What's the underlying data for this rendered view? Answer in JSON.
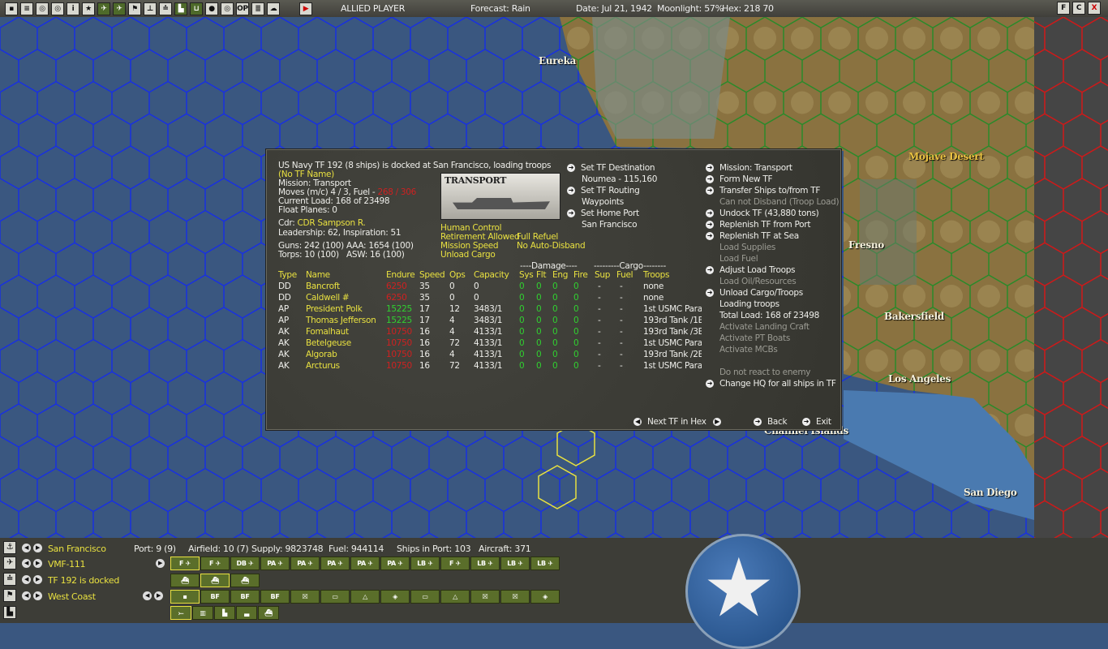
{
  "topbar": {
    "player": "ALLIED PLAYER",
    "forecast": "Forecast: Rain",
    "date": "Date: Jul 21, 1942",
    "moonlight": "Moonlight: 57%",
    "hex": "Hex: 218 70",
    "icons": [
      "save-icon",
      "report-icon",
      "intel-icon",
      "intel2-icon",
      "info-icon",
      "star-icon",
      "plane-red-icon",
      "plane-blue-icon",
      "flag-icon",
      "ship-icon",
      "ships-icon",
      "factory-icon",
      "base-icon",
      "globe-icon",
      "globe2-icon",
      "op-icon",
      "list-icon",
      "cloud-icon",
      "play-icon"
    ],
    "icon_glyphs": [
      "▪",
      "≡",
      "◎",
      "◎",
      "i",
      "★",
      "✈",
      "✈",
      "⚑",
      "⊥",
      "≐",
      "▙",
      "⊔",
      "●",
      "◎",
      "OP",
      "≣",
      "☁",
      "▶"
    ],
    "right_icons": [
      "F",
      "C",
      "X"
    ]
  },
  "map": {
    "labels": [
      "Eureka",
      "Mojave Desert",
      "Fresno",
      "Bakersfield",
      "Los Angeles",
      "Channel Islands",
      "San Diego"
    ]
  },
  "dialog": {
    "title": "US Navy TF 192 (8 ships) is docked at San Francisco, loading troops",
    "tf_name": "(No TF Name)",
    "mission": "Mission:  Transport",
    "moves": "Moves (m/c)  4 / 3, Fuel - ",
    "fuel": "268 / 306",
    "load": "Current Load:  168 of 23498",
    "float": "Float Planes:  0",
    "cdr_label": "Cdr:",
    "cdr": "CDR Sampson R.",
    "leadership": "Leadership: 62, Inspiration: 51",
    "guns": "Guns: 242 (100)",
    "aaa": "AAA: 1654 (100)",
    "torps": "Torps: 10 (100)",
    "asw": "ASW: 16 (100)",
    "image_label": "TRANSPORT",
    "flags": [
      "Human Control",
      "Retirement Allowed",
      "Full Refuel",
      "Mission Speed",
      "No Auto-Disband",
      "Unload Cargo"
    ],
    "mid_actions": [
      {
        "label": "Set TF Destination",
        "sub": "Noumea - 115,160"
      },
      {
        "label": "Set TF Routing",
        "sub": "Waypoints"
      },
      {
        "label": "Set Home Port",
        "sub": "San Francisco"
      }
    ],
    "right_actions": [
      {
        "label": "Mission: Transport",
        "arrow": true,
        "dim": false
      },
      {
        "label": "Form New TF",
        "arrow": true,
        "dim": false
      },
      {
        "label": "Transfer Ships to/from TF",
        "arrow": true,
        "dim": false
      },
      {
        "label": "Can not Disband (Troop Load)",
        "arrow": false,
        "dim": true
      },
      {
        "label": "Undock TF (43,880 tons)",
        "arrow": true,
        "dim": false
      },
      {
        "label": "Replenish TF from Port",
        "arrow": true,
        "dim": false
      },
      {
        "label": "Replenish TF at Sea",
        "arrow": true,
        "dim": false
      },
      {
        "label": "Load Supplies",
        "arrow": false,
        "dim": true
      },
      {
        "label": "Load Fuel",
        "arrow": false,
        "dim": true
      },
      {
        "label": "Adjust Load Troops",
        "arrow": true,
        "dim": false
      },
      {
        "label": "Load Oil/Resources",
        "arrow": false,
        "dim": true
      },
      {
        "label": "Unload Cargo/Troops",
        "arrow": true,
        "dim": false
      },
      {
        "label": "Loading troops",
        "arrow": false,
        "dim": false
      },
      {
        "label": "Total Load: 168 of 23498",
        "arrow": false,
        "dim": false
      },
      {
        "label": "Activate Landing Craft",
        "arrow": false,
        "dim": true
      },
      {
        "label": "Activate PT Boats",
        "arrow": false,
        "dim": true
      },
      {
        "label": "Activate MCBs",
        "arrow": false,
        "dim": true
      },
      {
        "label": "",
        "arrow": false,
        "dim": true
      },
      {
        "label": "Do not react to enemy",
        "arrow": false,
        "dim": true
      },
      {
        "label": "Change HQ for all ships in TF",
        "arrow": true,
        "dim": false
      }
    ],
    "damage_header": "----Damage----",
    "cargo_header": "---------Cargo--------",
    "columns": [
      "Type",
      "Name",
      "Endure",
      "Speed",
      "Ops",
      "Capacity",
      "Sys",
      "Flt",
      "Eng",
      "Fire",
      "Sup",
      "Fuel",
      "Troops"
    ],
    "ships": [
      [
        "DD",
        "Bancroft",
        "6250",
        "35",
        "0",
        "0",
        "0",
        "0",
        "0",
        "0",
        "-",
        "-",
        "none"
      ],
      [
        "DD",
        "Caldwell #",
        "6250",
        "35",
        "0",
        "0",
        "0",
        "0",
        "0",
        "0",
        "-",
        "-",
        "none"
      ],
      [
        "AP",
        "President Polk",
        "15225",
        "17",
        "12",
        "3483/1",
        "0",
        "0",
        "0",
        "0",
        "-",
        "-",
        "1st USMC Para"
      ],
      [
        "AP",
        "Thomas Jefferson",
        "15225",
        "17",
        "4",
        "3483/1",
        "0",
        "0",
        "0",
        "0",
        "-",
        "-",
        "193rd Tank /1E"
      ],
      [
        "AK",
        "Fomalhaut",
        "10750",
        "16",
        "4",
        "4133/1",
        "0",
        "0",
        "0",
        "0",
        "-",
        "-",
        "193rd Tank /3E"
      ],
      [
        "AK",
        "Betelgeuse",
        "10750",
        "16",
        "72",
        "4133/1",
        "0",
        "0",
        "0",
        "0",
        "-",
        "-",
        "1st USMC Para"
      ],
      [
        "AK",
        "Algorab",
        "10750",
        "16",
        "4",
        "4133/1",
        "0",
        "0",
        "0",
        "0",
        "-",
        "-",
        "193rd Tank /2E"
      ],
      [
        "AK",
        "Arcturus",
        "10750",
        "16",
        "72",
        "4133/1",
        "0",
        "0",
        "0",
        "0",
        "-",
        "-",
        "1st USMC Para"
      ]
    ],
    "endure_colors": [
      "#d02020",
      "#d02020",
      "#30d030",
      "#30d030",
      "#d02020",
      "#d02020",
      "#d02020",
      "#d02020"
    ],
    "next_tf": "Next TF in Hex",
    "back": "Back",
    "exit": "Exit"
  },
  "bottom": {
    "base": "San Francisco",
    "port": "Port: 9 (9)",
    "airfield": "Airfield: 10 (7)",
    "supply": "Supply: 9823748",
    "fuel": "Fuel: 944114",
    "ships": "Ships in Port: 103",
    "aircraft": "Aircraft: 371",
    "squadron": "VMF-111",
    "tf": "TF 192 is docked",
    "hq": "West Coast",
    "air_buttons": [
      "F ✈",
      "F ✈",
      "DB ✈",
      "PA ✈",
      "PA ✈",
      "PA ✈",
      "PA ✈",
      "PA ✈",
      "LB ✈",
      "F ✈",
      "LB ✈",
      "LB ✈",
      "LB ✈"
    ],
    "ship_buttons": [
      "⛴",
      "⛴",
      "⛴"
    ],
    "unit_buttons": [
      "▪",
      "BF",
      "BF",
      "BF",
      "☒",
      "▭",
      "△",
      "◈",
      "▭",
      "△",
      "☒",
      "☒",
      "◈"
    ],
    "misc_buttons": [
      "⤚",
      "▥",
      "▙",
      "▃",
      "⛴"
    ]
  }
}
